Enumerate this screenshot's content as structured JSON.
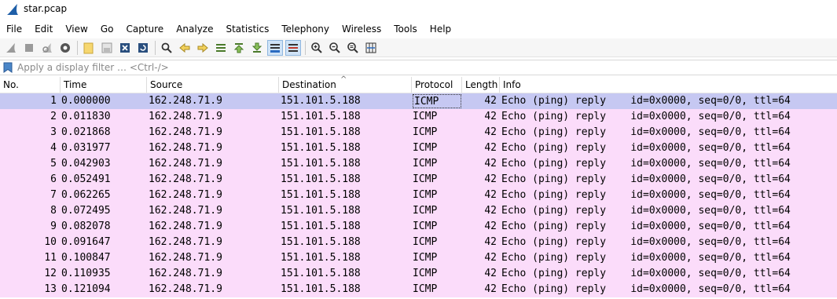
{
  "window": {
    "title": "star.pcap"
  },
  "menu": [
    "File",
    "Edit",
    "View",
    "Go",
    "Capture",
    "Analyze",
    "Statistics",
    "Telephony",
    "Wireless",
    "Tools",
    "Help"
  ],
  "toolbar": {
    "icons": [
      "start-capture-icon",
      "stop-capture-icon",
      "restart-capture-icon",
      "capture-options-icon",
      "open-file-icon",
      "save-file-icon",
      "close-file-icon",
      "reload-file-icon",
      "find-packet-icon",
      "go-back-icon",
      "go-forward-icon",
      "go-to-packet-icon",
      "first-packet-icon",
      "last-packet-icon",
      "autoscroll-icon",
      "colorize-icon",
      "zoom-in-icon",
      "zoom-out-icon",
      "normal-size-icon",
      "resize-columns-icon"
    ],
    "active": [
      "autoscroll-icon",
      "colorize-icon"
    ]
  },
  "filter": {
    "placeholder": "Apply a display filter … <Ctrl-/>",
    "value": ""
  },
  "columns": [
    "No.",
    "Time",
    "Source",
    "Destination",
    "Protocol",
    "Length",
    "Info"
  ],
  "sort_indicator": "^",
  "colors": {
    "row_bg": "#fbdcfa",
    "selected_bg": "#c6c8f2"
  },
  "packets": [
    {
      "no": "1",
      "time": "0.000000",
      "source": "162.248.71.9",
      "destination": "151.101.5.188",
      "protocol": "ICMP",
      "length": "42",
      "info": "Echo (ping) reply    id=0x0000, seq=0/0, ttl=64",
      "selected": true
    },
    {
      "no": "2",
      "time": "0.011830",
      "source": "162.248.71.9",
      "destination": "151.101.5.188",
      "protocol": "ICMP",
      "length": "42",
      "info": "Echo (ping) reply    id=0x0000, seq=0/0, ttl=64"
    },
    {
      "no": "3",
      "time": "0.021868",
      "source": "162.248.71.9",
      "destination": "151.101.5.188",
      "protocol": "ICMP",
      "length": "42",
      "info": "Echo (ping) reply    id=0x0000, seq=0/0, ttl=64"
    },
    {
      "no": "4",
      "time": "0.031977",
      "source": "162.248.71.9",
      "destination": "151.101.5.188",
      "protocol": "ICMP",
      "length": "42",
      "info": "Echo (ping) reply    id=0x0000, seq=0/0, ttl=64"
    },
    {
      "no": "5",
      "time": "0.042903",
      "source": "162.248.71.9",
      "destination": "151.101.5.188",
      "protocol": "ICMP",
      "length": "42",
      "info": "Echo (ping) reply    id=0x0000, seq=0/0, ttl=64"
    },
    {
      "no": "6",
      "time": "0.052491",
      "source": "162.248.71.9",
      "destination": "151.101.5.188",
      "protocol": "ICMP",
      "length": "42",
      "info": "Echo (ping) reply    id=0x0000, seq=0/0, ttl=64"
    },
    {
      "no": "7",
      "time": "0.062265",
      "source": "162.248.71.9",
      "destination": "151.101.5.188",
      "protocol": "ICMP",
      "length": "42",
      "info": "Echo (ping) reply    id=0x0000, seq=0/0, ttl=64"
    },
    {
      "no": "8",
      "time": "0.072495",
      "source": "162.248.71.9",
      "destination": "151.101.5.188",
      "protocol": "ICMP",
      "length": "42",
      "info": "Echo (ping) reply    id=0x0000, seq=0/0, ttl=64"
    },
    {
      "no": "9",
      "time": "0.082078",
      "source": "162.248.71.9",
      "destination": "151.101.5.188",
      "protocol": "ICMP",
      "length": "42",
      "info": "Echo (ping) reply    id=0x0000, seq=0/0, ttl=64"
    },
    {
      "no": "10",
      "time": "0.091647",
      "source": "162.248.71.9",
      "destination": "151.101.5.188",
      "protocol": "ICMP",
      "length": "42",
      "info": "Echo (ping) reply    id=0x0000, seq=0/0, ttl=64"
    },
    {
      "no": "11",
      "time": "0.100847",
      "source": "162.248.71.9",
      "destination": "151.101.5.188",
      "protocol": "ICMP",
      "length": "42",
      "info": "Echo (ping) reply    id=0x0000, seq=0/0, ttl=64"
    },
    {
      "no": "12",
      "time": "0.110935",
      "source": "162.248.71.9",
      "destination": "151.101.5.188",
      "protocol": "ICMP",
      "length": "42",
      "info": "Echo (ping) reply    id=0x0000, seq=0/0, ttl=64"
    },
    {
      "no": "13",
      "time": "0.121094",
      "source": "162.248.71.9",
      "destination": "151.101.5.188",
      "protocol": "ICMP",
      "length": "42",
      "info": "Echo (ping) reply    id=0x0000, seq=0/0, ttl=64"
    }
  ]
}
